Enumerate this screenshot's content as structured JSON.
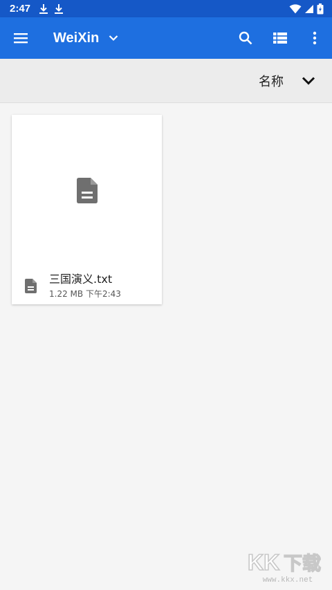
{
  "status_bar": {
    "time": "2:47",
    "icons": [
      "download-icon",
      "download-icon",
      "wifi-icon",
      "cell-signal-icon",
      "battery-icon"
    ]
  },
  "app_bar": {
    "title": "WeiXin",
    "icons": [
      "menu-icon",
      "chevron-down-icon",
      "search-icon",
      "list-view-icon",
      "more-vert-icon"
    ],
    "color": "#1e6fe0"
  },
  "sort_bar": {
    "label": "名称",
    "toggle_icon": "chevron-down-icon"
  },
  "files": [
    {
      "name": "三国演义.txt",
      "size": "1.22 MB",
      "modified": "下午2:43",
      "icon": "document-icon"
    }
  ],
  "watermark": {
    "logo_text": "KK下载",
    "url": "www.kkx.net"
  }
}
